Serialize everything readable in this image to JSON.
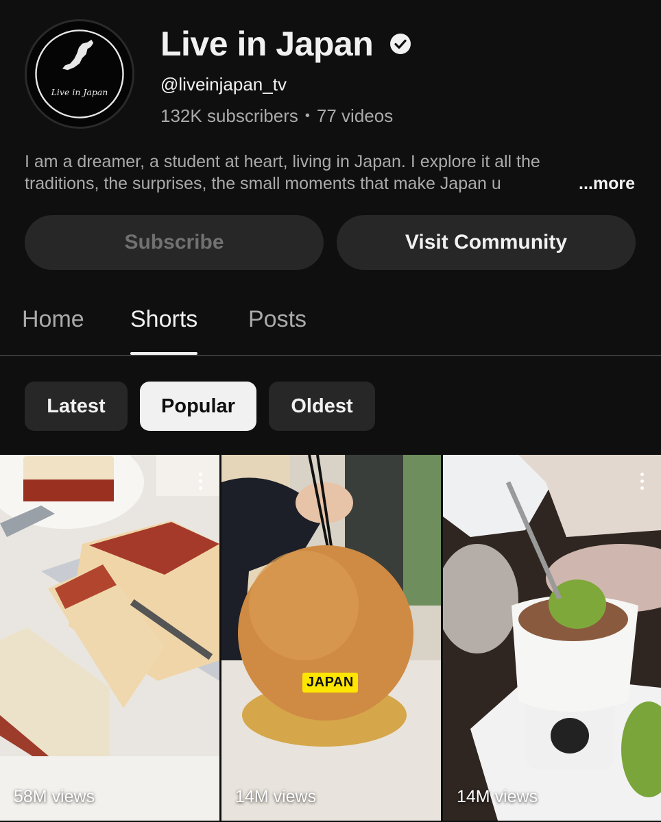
{
  "channel": {
    "title": "Live in Japan",
    "handle": "@liveinjapan_tv",
    "subscribers": "132K subscribers",
    "separator": "•",
    "videos": "77 videos",
    "avatar_text": "Live in Japan",
    "verified_icon": "verified-check-icon",
    "description_line1": "I am a dreamer, a student at heart, living in Japan. I explore it all the",
    "description_line2": "traditions, the surprises, the small moments that make Japan u",
    "more_label": "...more"
  },
  "actions": {
    "subscribe_label": "Subscribe",
    "community_label": "Visit Community"
  },
  "tabs": [
    {
      "label": "Home",
      "active": false
    },
    {
      "label": "Shorts",
      "active": true
    },
    {
      "label": "Posts",
      "active": false
    }
  ],
  "filters": [
    {
      "label": "Latest",
      "active": false
    },
    {
      "label": "Popular",
      "active": true
    },
    {
      "label": "Oldest",
      "active": false
    }
  ],
  "shorts": [
    {
      "views": "58M views",
      "thumbnail": "cheesecake-being-sliced"
    },
    {
      "views": "14M views",
      "thumbnail": "giant-sesame-ball-with-chopsticks",
      "badge": "JAPAN"
    },
    {
      "views": "14M views",
      "thumbnail": "matcha-crumble-dipped-in-chocolate"
    }
  ],
  "colors": {
    "background": "#0f0f0f",
    "chip_active": "#f1f1f1",
    "button_bg": "#272727",
    "badge_yellow": "#ffe600"
  }
}
